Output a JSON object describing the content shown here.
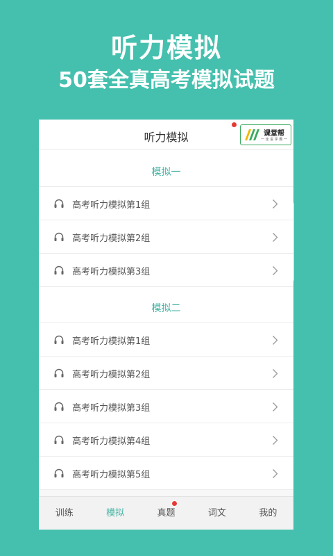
{
  "promo": {
    "title": "听力模拟",
    "subtitle": "50套全真高考模拟试题"
  },
  "header": {
    "title": "听力模拟",
    "logo_text": "课堂帮",
    "logo_sub": "一 走 进 学 霸 一"
  },
  "sections": [
    {
      "title": "模拟一",
      "items": [
        "高考听力模拟第1组",
        "高考听力模拟第2组",
        "高考听力模拟第3组"
      ]
    },
    {
      "title": "模拟二",
      "items": [
        "高考听力模拟第1组",
        "高考听力模拟第2组",
        "高考听力模拟第3组",
        "高考听力模拟第4组",
        "高考听力模拟第5组"
      ]
    }
  ],
  "tabs": [
    {
      "label": "训练",
      "active": false
    },
    {
      "label": "模拟",
      "active": true
    },
    {
      "label": "真题",
      "active": false,
      "badge": true
    },
    {
      "label": "词文",
      "active": false
    },
    {
      "label": "我的",
      "active": false
    }
  ],
  "colors": {
    "background": "#45c0ae",
    "accent": "#45b3a3",
    "badge": "#e53935"
  },
  "icons": {
    "item": "headphones-icon",
    "chevron": "chevron-right-icon"
  }
}
